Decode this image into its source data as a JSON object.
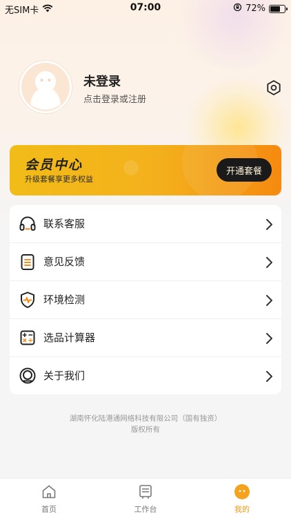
{
  "status_bar": {
    "carrier": "无SIM卡",
    "time": "07:00",
    "battery": "72%",
    "battery_level": 0.72
  },
  "profile": {
    "title": "未登录",
    "subtitle": "点击登录或注册",
    "settings_icon": "hexagon-settings-icon"
  },
  "member": {
    "title": "会员中心",
    "subtitle": "升级套餐享更多权益",
    "button": "开通套餐"
  },
  "menu": {
    "items": [
      {
        "label": "联系客服",
        "icon": "headset-icon"
      },
      {
        "label": "意见反馈",
        "icon": "clipboard-icon"
      },
      {
        "label": "环境检测",
        "icon": "shield-pulse-icon"
      },
      {
        "label": "选品计算器",
        "icon": "calculator-icon"
      },
      {
        "label": "关于我们",
        "icon": "circle-badge-icon"
      }
    ]
  },
  "footer": {
    "line1": "湖南怀化陆港通网络科技有限公司（国有独资）",
    "line2": "版权所有"
  },
  "tabs": [
    {
      "label": "首页",
      "icon": "home-icon",
      "active": false
    },
    {
      "label": "工作台",
      "icon": "workbench-icon",
      "active": false
    },
    {
      "label": "我的",
      "icon": "smiley-icon",
      "active": true
    }
  ],
  "colors": {
    "accent": "#f29a12",
    "member_gradient_start": "#f1bc18",
    "member_gradient_end": "#f58a10",
    "icon_orange": "#f28c1e"
  }
}
